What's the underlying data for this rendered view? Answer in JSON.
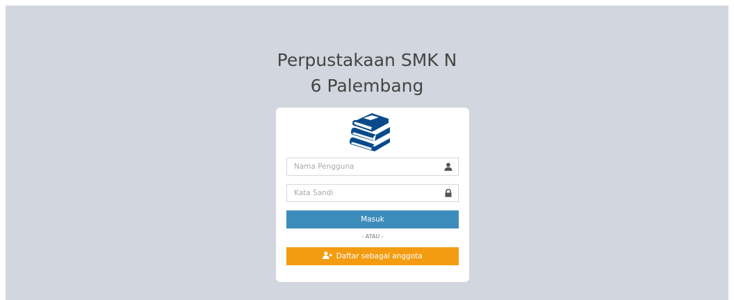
{
  "app": {
    "title_line1": "Perpustakaan SMK N",
    "title_line2": "6 Palembang"
  },
  "login_form": {
    "username_placeholder": "Nama Pengguna",
    "password_placeholder": "Kata Sandi",
    "submit_label": "Masuk",
    "divider_text": "- ATAU -",
    "register_label": "Daftar sebagai anggota"
  },
  "icons": {
    "logo": "books-icon",
    "username": "user-icon",
    "password": "lock-icon",
    "register": "user-plus-icon"
  },
  "colors": {
    "background": "#d2d6de",
    "logo": "#0a4a8a",
    "primary": "#3c8dbc",
    "warning": "#f39c12"
  }
}
